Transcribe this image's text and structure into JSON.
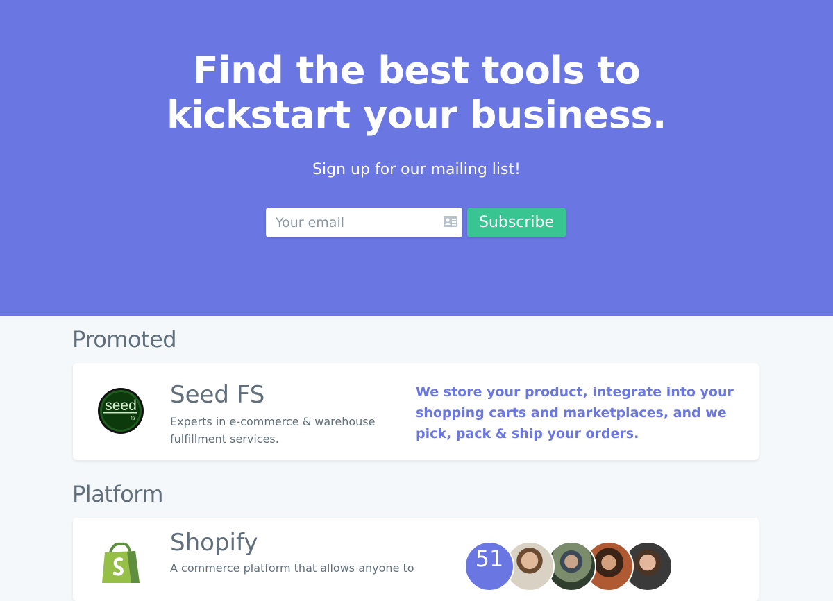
{
  "hero": {
    "title_line1": "Find the best tools to",
    "title_line2": "kickstart your business.",
    "subtitle": "Sign up for our mailing list!",
    "email_placeholder": "Your email",
    "subscribe_label": "Subscribe",
    "background": "#6a77e3",
    "button_color": "#38c592"
  },
  "sections": {
    "promoted": {
      "heading": "Promoted",
      "card": {
        "logo_text": "seed",
        "logo_subtext": "fs",
        "name": "Seed FS",
        "description": "Experts in e-commerce & warehouse fulfillment services.",
        "tagline": "We store your product, integrate into your shopping carts and marketplaces, and we pick, pack & ship your orders."
      }
    },
    "platform": {
      "heading": "Platform",
      "card": {
        "name": "Shopify",
        "description": "A commerce platform that allows anyone to",
        "user_count": "51",
        "logo_icon": "shopping-bag-icon"
      }
    }
  }
}
